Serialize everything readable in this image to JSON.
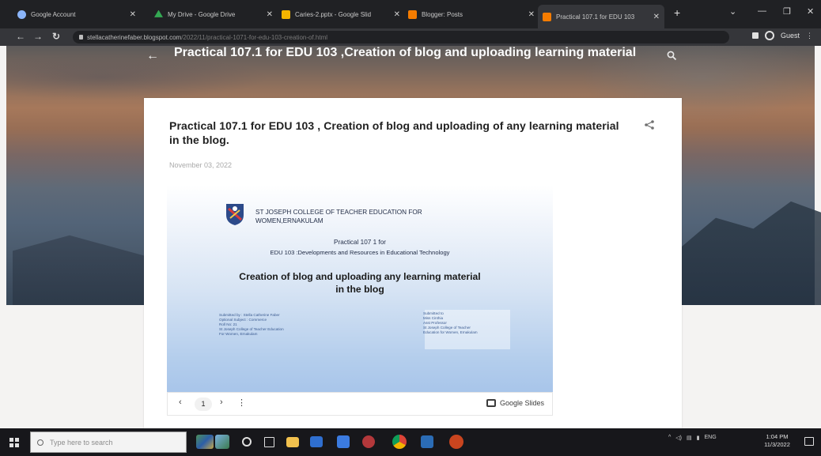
{
  "browser": {
    "tabs": [
      {
        "label": "Google Account",
        "favicon_color": "#8ab4f8"
      },
      {
        "label": "My Drive - Google Drive",
        "favicon_color": "#34a853"
      },
      {
        "label": "Caries-2.pptx - Google Slid",
        "favicon_color": "#f4b400"
      },
      {
        "label": "Blogger: Posts",
        "favicon_color": "#f57c00"
      },
      {
        "label": "Practical 107.1 for EDU 103",
        "favicon_color": "#f57c00"
      }
    ],
    "active_tab_index": 4,
    "url_host": "stellacatherinefaber.blogspot.com",
    "url_path": "/2022/11/practical-1071-for-edu-103-creation-of.html",
    "profile_label": "Guest"
  },
  "blog": {
    "header_title": "Practical 107.1 for EDU 103 ,Creation of blog and uploading learning material",
    "post_title": "Practical 107.1 for EDU 103 , Creation of blog and uploading of any learning material in the blog.",
    "post_date": "November 03, 2022"
  },
  "slide": {
    "college_line1": "ST JOSEPH COLLEGE OF TEACHER EDUCATION FOR",
    "college_line2": "WOMEN,ERNAKULAM",
    "practical_number": "Practical 107 1 for",
    "course": "EDU 103 :Developments and Resources in Educational Technology",
    "title_line1": "Creation of blog and uploading any learning material",
    "title_line2": "in the blog",
    "submitted_by": [
      "Submitted by : Stella Catherine Faber",
      "Optional Subject : Commerce",
      "Roll No: 21",
      "St Joseph College of Teacher Education",
      "For Women, Ernakulam"
    ],
    "submitted_to": [
      "Submitted to",
      "Miss Cinthia",
      "Asst Professor",
      "St Joseph College of Teacher",
      "Education for Women, Ernakulam"
    ]
  },
  "slides_controls": {
    "current_page": "1",
    "brand": "Google Slides"
  },
  "taskbar": {
    "search_placeholder": "Type here to search",
    "language": "ENG",
    "time": "1:04 PM",
    "date": "11/3/2022"
  }
}
